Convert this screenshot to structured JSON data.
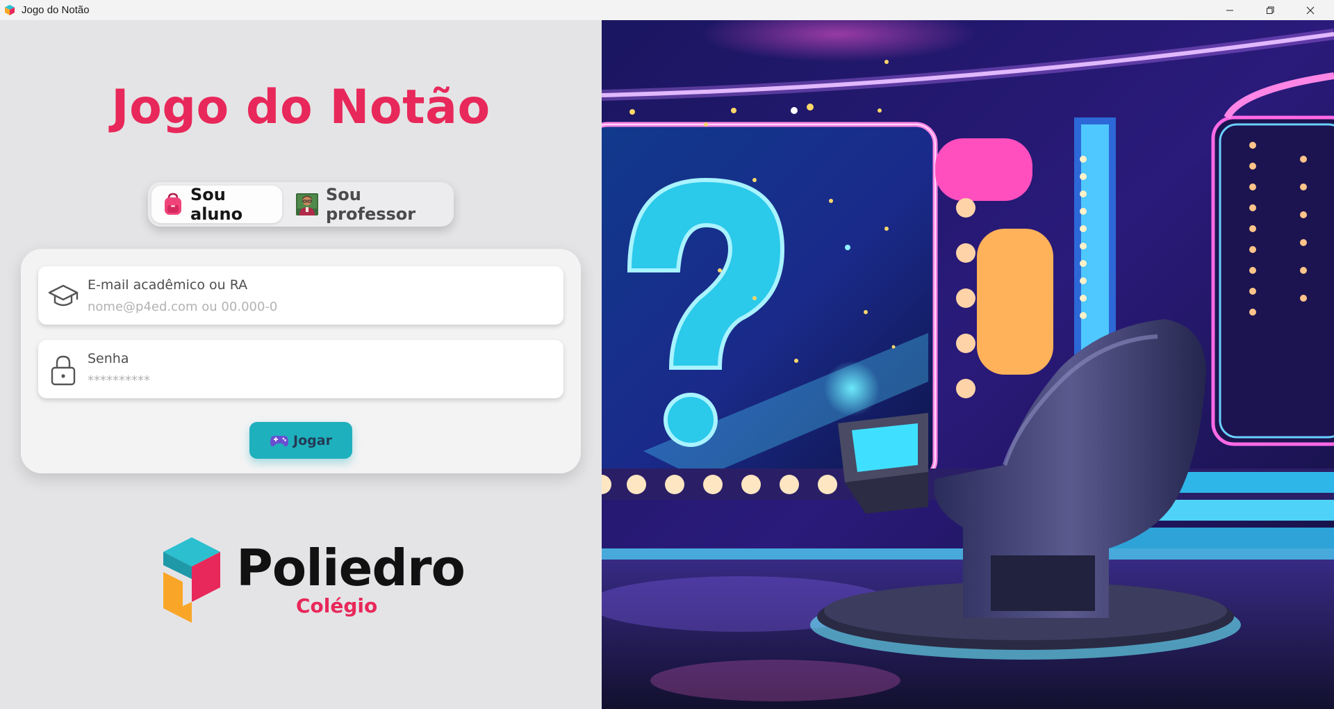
{
  "window": {
    "title": "Jogo do Notão",
    "controls": [
      "minimize",
      "restore",
      "close"
    ]
  },
  "app": {
    "title": "Jogo do Notão"
  },
  "role_toggle": {
    "student_label": "Sou aluno",
    "teacher_label": "Sou professor",
    "selected": "student",
    "student_icon": "backpack-icon",
    "teacher_icon": "teacher-icon"
  },
  "login": {
    "email_label": "E-mail acadêmico ou RA",
    "email_placeholder": "nome@p4ed.com ou 00.000-0",
    "email_icon": "graduation-cap-icon",
    "password_label": "Senha",
    "password_placeholder": "**********",
    "password_icon": "lock-icon",
    "play_label": "Jogar",
    "play_icon": "game-controller-icon"
  },
  "brand": {
    "name": "Poliedro",
    "subtitle": "Colégio"
  },
  "colors": {
    "accent": "#e8285a",
    "button": "#1fb0bd",
    "button_text": "#243a55",
    "panel_bg": "#e4e4e6",
    "card_bg": "#f3f3f4",
    "logo_teal": "#2bbfcf",
    "logo_pink": "#e8285a",
    "logo_orange": "#f9a628"
  }
}
